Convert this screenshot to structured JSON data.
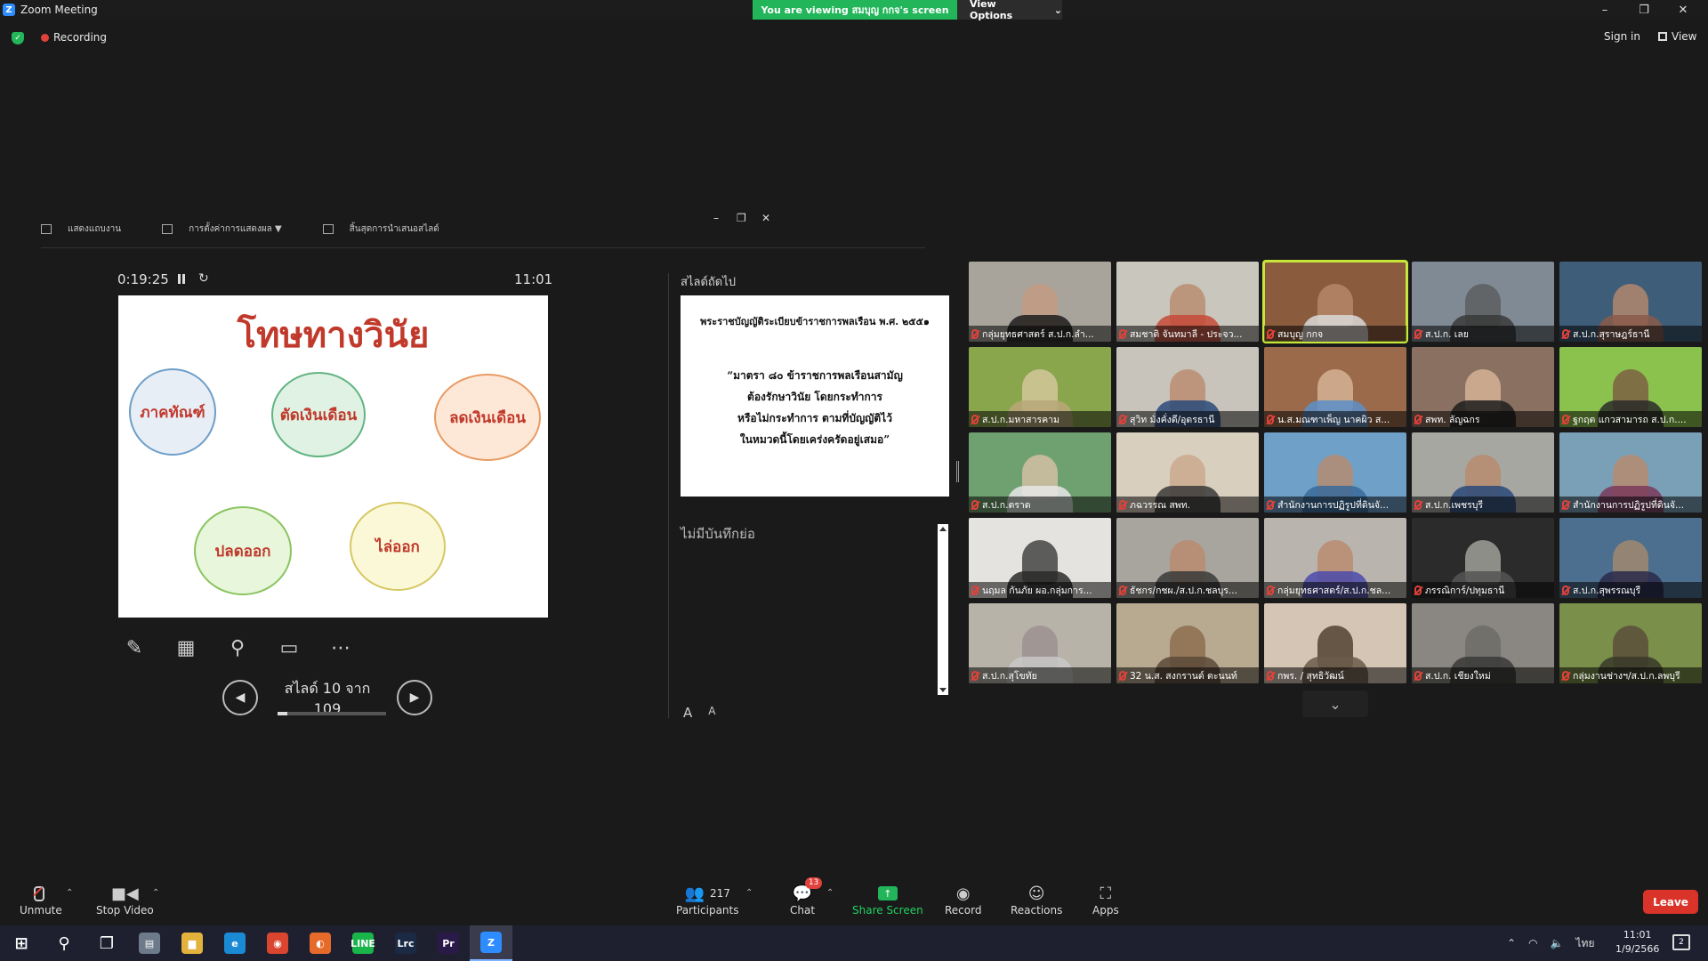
{
  "window": {
    "title": "Zoom Meeting",
    "viewing_banner": "You are viewing สมบุญ กกจ's screen",
    "view_options": "View Options",
    "minimize": "–",
    "restore": "❐",
    "close": "✕"
  },
  "status": {
    "recording": "Recording",
    "sign_in": "Sign in",
    "view": "View"
  },
  "presenter": {
    "toolbar": [
      "แสดงแถบงาน",
      "การตั้งค่าการแสดงผล ▼",
      "สิ้นสุดการนำเสนอสไลด์"
    ],
    "timer": "0:19:25",
    "clock": "11:01",
    "slide": {
      "title": "โทษทางวินัย",
      "circles": [
        "ภาคทัณฑ์",
        "ตัดเงินเดือน",
        "ลดเงินเดือน",
        "ปลดออก",
        "ไล่ออก"
      ]
    },
    "slide_counter": "สไลด์ 10 จาก 109",
    "progress": 0.092,
    "next_label": "สไลด์ถัดไป",
    "next_slide": {
      "heading": "พระราชบัญญัติระเบียบข้าราชการพลเรือน พ.ศ. ๒๕๕๑",
      "body": [
        "“มาตรา ๘๐ ข้าราชการพลเรือนสามัญ",
        "ต้องรักษาวินัย โดยกระทำการ",
        "หรือไม่กระทำการ ตามที่บัญญัติไว้",
        "ในหมวดนี้โดยเคร่งครัดอยู่เสมอ”"
      ]
    },
    "notes": "ไม่มีบันทึกย่อ",
    "font_inc": "A",
    "font_dec": "A"
  },
  "participants": [
    {
      "name": "กลุ่มยุทธศาสตร์ ส.ป.ก.ลำ...",
      "bg": "#a9a49b",
      "skin": "#c49a80",
      "shirt": "#1d1d1d"
    },
    {
      "name": "สมชาติ จันทมาลี - ประจว...",
      "bg": "#c9c6bd",
      "skin": "#b98a6c",
      "shirt": "#c74a3a"
    },
    {
      "name": "สมบุญ กกจ",
      "bg": "#8b5b3e",
      "skin": "#b98a6c",
      "shirt": "#d9d9d9",
      "active": true
    },
    {
      "name": "ส.ป.ก. เลย",
      "bg": "#7f8a95",
      "skin": "#5b5b5b",
      "shirt": "#3a3a3a"
    },
    {
      "name": "ส.ป.ก.สุราษฎร์ธานี",
      "bg": "#3e5d78",
      "skin": "#b98a6c",
      "shirt": "#8a5a4a"
    },
    {
      "name": "ส.ป.ก.มหาสารคาม",
      "bg": "#8aa64d",
      "skin": "#d7c9a0",
      "shirt": "#b9a77a"
    },
    {
      "name": "สุวิท มั่งคั่งดี/อุดรธานี",
      "bg": "#c8c4bc",
      "skin": "#b98a6c",
      "shirt": "#2a4a7a"
    },
    {
      "name": "น.ส.มณฑาเพ็ญ นาคผิว ส...",
      "bg": "#9b6a4a",
      "skin": "#d9b79a",
      "shirt": "#5a8fc8"
    },
    {
      "name": "สพท. ลัญฉกร",
      "bg": "#8a7060",
      "skin": "#d9b79a",
      "shirt": "#1d1d1d"
    },
    {
      "name": "ฐกฤต แกวสามารถ ส.ป.ก....",
      "bg": "#8ac24d",
      "skin": "#7a5a44",
      "shirt": "#2a2a2a"
    },
    {
      "name": "ส.ป.ก.ตราด",
      "bg": "#6fa070",
      "skin": "#d9c0a8",
      "shirt": "#e8e8e8"
    },
    {
      "name": "ภฉวรรณ สพท.",
      "bg": "#d8cfbe",
      "skin": "#c9a68a",
      "shirt": "#3a3a3a"
    },
    {
      "name": "สำนักงานการปฏิรูปที่ดินจั...",
      "bg": "#6fa0c8",
      "skin": "#b98a6c",
      "shirt": "#3a6a9a"
    },
    {
      "name": "ส.ป.ก.เพชรบุรี",
      "bg": "#a7a7a2",
      "skin": "#b98a6c",
      "shirt": "#2a4a7a"
    },
    {
      "name": "สำนักงานการปฏิรูปที่ดินจั...",
      "bg": "#7aa0b8",
      "skin": "#b98a6c",
      "shirt": "#7a3a5a"
    },
    {
      "name": "นฤมล กันภัย ผอ.กลุ่มการ...",
      "bg": "#e5e3df",
      "skin": "#3a3a3a",
      "shirt": "#2a2a2a"
    },
    {
      "name": "ธัชกร/กชผ./ส.ป.ก.ชลบุร...",
      "bg": "#a8a59e",
      "skin": "#b98a6c",
      "shirt": "#3a3a3a"
    },
    {
      "name": "กลุ่มยุทธศาสตร์/ส.ป.ก.ชล...",
      "bg": "#b9b4ae",
      "skin": "#b98a6c",
      "shirt": "#4a4aaa"
    },
    {
      "name": "ภรรณิการ์/ปทุมธานี",
      "bg": "#2b2b2b",
      "skin": "#a8a8a0",
      "shirt": "#555555"
    },
    {
      "name": "ส.ป.ก.สุพรรณบุรี",
      "bg": "#4d6f8f",
      "skin": "#a68a6c",
      "shirt": "#2a2a4a"
    },
    {
      "name": "ส.ป.ก.สุโขทัย",
      "bg": "#b8b3a8",
      "skin": "#9a9090",
      "shirt": "#c8c8c8"
    },
    {
      "name": "32 น.ส. สงกรานต์ ตะนนท์",
      "bg": "#b8aa90",
      "skin": "#8a6a4a",
      "shirt": "#5a4a3a"
    },
    {
      "name": "กพร. / สุทธิวัฒน์",
      "bg": "#d4c5b5",
      "skin": "#4a3a2a",
      "shirt": "#6a5a4a"
    },
    {
      "name": "ส.ป.ก. เชียงใหม่",
      "bg": "#8a8782",
      "skin": "#6a6a64",
      "shirt": "#3a3a3a"
    },
    {
      "name": "กลุ่มงานช่างฯ/ส.ป.ก.ลพบุรี",
      "bg": "#7a8f4a",
      "skin": "#5a4a3a",
      "shirt": "#3a3a2a"
    }
  ],
  "toolbar": {
    "unmute": "Unmute",
    "stop_video": "Stop Video",
    "participants": "Participants",
    "participant_count": "217",
    "chat": "Chat",
    "chat_badge": "13",
    "share_screen": "Share Screen",
    "record": "Record",
    "reactions": "Reactions",
    "apps": "Apps",
    "leave": "Leave"
  },
  "taskbar": {
    "apps": [
      {
        "name": "windows-start-icon",
        "label": "⊞",
        "color": "transparent"
      },
      {
        "name": "search-icon",
        "label": "⚲",
        "color": "transparent"
      },
      {
        "name": "task-view-icon",
        "label": "❐",
        "color": "transparent"
      },
      {
        "name": "explorer-icon",
        "label": "▤",
        "color": "#6c7a8a"
      },
      {
        "name": "folder-icon",
        "label": "▆",
        "color": "#e3b23c"
      },
      {
        "name": "edge-icon",
        "label": "e",
        "color": "#1a8ad4"
      },
      {
        "name": "chrome-icon",
        "label": "◉",
        "color": "#d9452f"
      },
      {
        "name": "firefox-icon",
        "label": "◐",
        "color": "#e66b2a"
      },
      {
        "name": "line-icon",
        "label": "LINE",
        "color": "#19b54a"
      },
      {
        "name": "lightroom-icon",
        "label": "Lrc",
        "color": "#1b2a44"
      },
      {
        "name": "premiere-icon",
        "label": "Pr",
        "color": "#2a1a4a"
      },
      {
        "name": "zoom-icon",
        "label": "Z",
        "color": "#2d8cff"
      }
    ],
    "lang": "ไทย",
    "time": "11:01",
    "date": "1/9/2566",
    "notif_count": "2"
  }
}
